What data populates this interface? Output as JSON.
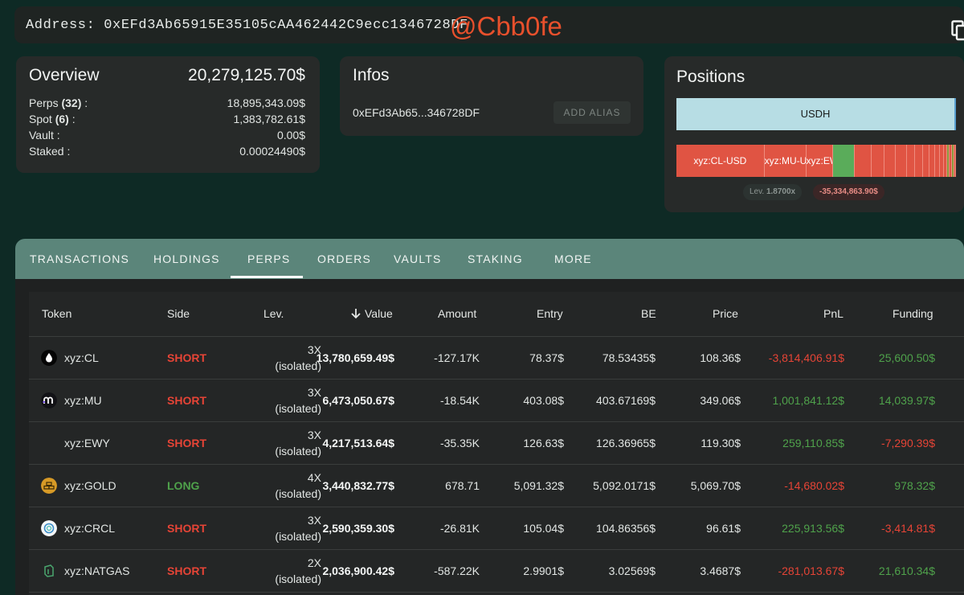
{
  "address_bar": {
    "label": "Address: 0xEFd3Ab65915E35105cAA462442C9ecc1346728DF",
    "watermark": "@Cbb0fe",
    "copy_icon": "copy-icon"
  },
  "overview": {
    "title": "Overview",
    "total": "20,279,125.70$",
    "rows": [
      {
        "label": "Perps ",
        "count": "(32)",
        "suffix": " :",
        "value": "18,895,343.09$"
      },
      {
        "label": "Spot ",
        "count": "(6)",
        "suffix": " :",
        "value": "1,383,782.61$"
      },
      {
        "label": "Vault :",
        "count": "",
        "suffix": "",
        "value": "0.00$"
      },
      {
        "label": "Staked :",
        "count": "",
        "suffix": "",
        "value": "0.00024490$"
      }
    ]
  },
  "infos": {
    "title": "Infos",
    "short_address": "0xEFd3Ab65...346728DF",
    "add_alias": "ADD ALIAS"
  },
  "positions": {
    "title": "Positions",
    "usdh_label": "USDH",
    "segments": [
      "xyz:CL-USD",
      "xyz:MU-USD",
      "xyz:EWY-USD"
    ],
    "lev_label": "Lev.",
    "lev_value": "1.8700x",
    "pnl": "-35,334,863.90$",
    "colors": {
      "short": "#e05443",
      "long": "#5aac5a",
      "usdh": "#b7dde4"
    }
  },
  "tabs": [
    "TRANSACTIONS",
    "HOLDINGS",
    "PERPS",
    "ORDERS",
    "VAULTS",
    "STAKING",
    "MORE"
  ],
  "active_tab": "PERPS",
  "table": {
    "headers": {
      "token": "Token",
      "side": "Side",
      "lev": "Lev.",
      "value": "Value",
      "amount": "Amount",
      "entry": "Entry",
      "be": "BE",
      "price": "Price",
      "pnl": "PnL",
      "funding": "Funding"
    },
    "sort_icon": "arrow-down-icon",
    "rows": [
      {
        "token": "xyz:CL",
        "icon": "oil-drop-icon",
        "side": "SHORT",
        "lev": "3X",
        "lev_mode": "(isolated)",
        "value": "13,780,659.49$",
        "amount": "-127.17K",
        "entry": "78.37$",
        "be": "78.53435$",
        "price": "108.36$",
        "pnl": "-3,814,406.91$",
        "funding": "25,600.50$"
      },
      {
        "token": "xyz:MU",
        "icon": "micron-logo-icon",
        "side": "SHORT",
        "lev": "3X",
        "lev_mode": "(isolated)",
        "value": "6,473,050.67$",
        "amount": "-18.54K",
        "entry": "403.08$",
        "be": "403.67169$",
        "price": "349.06$",
        "pnl": "1,001,841.12$",
        "funding": "14,039.97$"
      },
      {
        "token": "xyz:EWY",
        "icon": "",
        "side": "SHORT",
        "lev": "3X",
        "lev_mode": "(isolated)",
        "value": "4,217,513.64$",
        "amount": "-35.35K",
        "entry": "126.63$",
        "be": "126.36965$",
        "price": "119.30$",
        "pnl": "259,110.85$",
        "funding": "-7,290.39$"
      },
      {
        "token": "xyz:GOLD",
        "icon": "gold-bars-icon",
        "side": "LONG",
        "lev": "4X",
        "lev_mode": "(isolated)",
        "value": "3,440,832.77$",
        "amount": "678.71",
        "entry": "5,091.32$",
        "be": "5,092.0171$",
        "price": "5,069.70$",
        "pnl": "-14,680.02$",
        "funding": "978.32$"
      },
      {
        "token": "xyz:CRCL",
        "icon": "circle-logo-icon",
        "side": "SHORT",
        "lev": "3X",
        "lev_mode": "(isolated)",
        "value": "2,590,359.30$",
        "amount": "-26.81K",
        "entry": "105.04$",
        "be": "104.86356$",
        "price": "96.61$",
        "pnl": "225,913.56$",
        "funding": "-3,414.81$"
      },
      {
        "token": "xyz:NATGAS",
        "icon": "gas-flame-icon",
        "side": "SHORT",
        "lev": "2X",
        "lev_mode": "(isolated)",
        "value": "2,036,900.42$",
        "amount": "-587.22K",
        "entry": "2.9901$",
        "be": "3.02569$",
        "price": "3.4687$",
        "pnl": "-281,013.67$",
        "funding": "21,610.34$"
      }
    ]
  }
}
